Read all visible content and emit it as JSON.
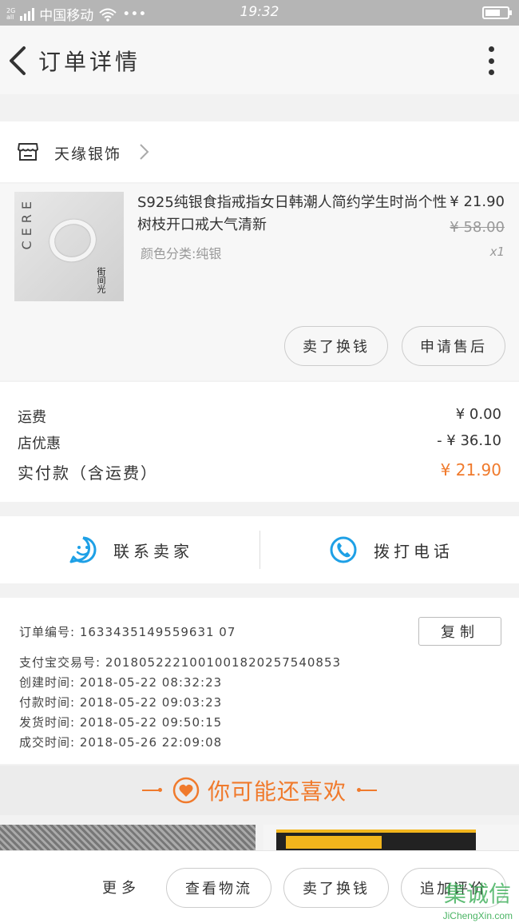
{
  "status_bar": {
    "network": "2G",
    "network_sub": "all",
    "carrier": "中国移动",
    "time": "19:32"
  },
  "header": {
    "title": "订单详情"
  },
  "shop": {
    "name": "天缘银饰"
  },
  "product": {
    "thumb_brand": "CERE",
    "thumb_seal": "街间光",
    "name": "S925纯银食指戒指女日韩潮人简约学生时尚个性树枝开口戒大气清新",
    "variant": "颜色分类:纯银",
    "price": "¥ 21.90",
    "original_price": "¥ 58.00",
    "quantity": "x1",
    "actions": {
      "buy_again": "卖了换钱",
      "after_sale": "申请售后"
    }
  },
  "fees": {
    "shipping_label": "运费",
    "shipping_value": "¥ 0.00",
    "discount_label": "店优惠",
    "discount_value": "- ¥ 36.10",
    "paid_label": "实付款（含运费）",
    "paid_value": "¥ 21.90"
  },
  "contact": {
    "seller_label": "联系卖家",
    "call_label": "拨打电话"
  },
  "order_info": {
    "order_no_label": "订单编号:",
    "order_no": "1633435149559631 07",
    "copy_label": "复制",
    "alipay_label": "支付宝交易号:",
    "alipay_no": "2018052221001001820257540853",
    "created_label": "创建时间:",
    "created": "2018-05-22 08:32:23",
    "paid_label": "付款时间:",
    "paid": "2018-05-22 09:03:23",
    "shipped_label": "发货时间:",
    "shipped": "2018-05-22 09:50:15",
    "completed_label": "成交时间:",
    "completed": "2018-05-26 22:09:08"
  },
  "recommend": {
    "label": "你可能还喜欢"
  },
  "bottom_bar": {
    "more": "更多",
    "logistics": "查看物流",
    "sell": "卖了换钱",
    "review": "追加评价"
  },
  "watermark": {
    "glyphs": "集诚信",
    "url": "JiChengXin.com"
  },
  "colors": {
    "accent": "#f07a2c",
    "contact_blue": "#1ea0e6",
    "status_bar": "#b5b5b5"
  },
  "icons": [
    "back-arrow-icon",
    "more-vertical-icon",
    "shop-icon",
    "chevron-right-icon",
    "chat-smile-icon",
    "phone-icon",
    "heart-icon"
  ]
}
